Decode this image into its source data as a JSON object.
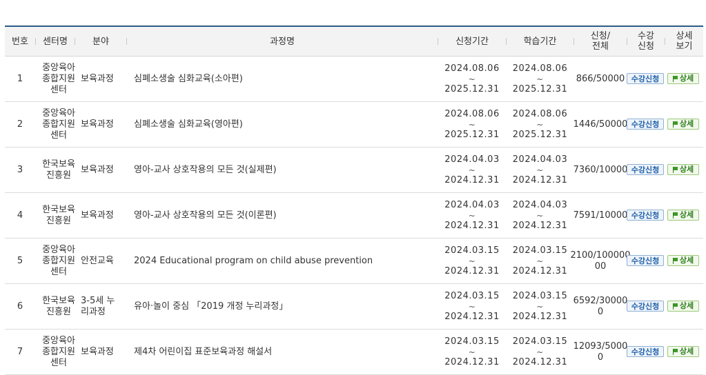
{
  "table": {
    "headers": {
      "no": "번호",
      "center": "센터명",
      "field": "분야",
      "course": "과정명",
      "apply_period": "신청기간",
      "study_period": "학습기간",
      "count": "신청/\n전체",
      "enroll": "수강\n신청",
      "detail": "상세\n보기"
    },
    "apply_label": "수강신청",
    "detail_label": "상세",
    "tilde": "~",
    "rows": [
      {
        "no": "1",
        "center": "중앙육아\n종합지원\n센터",
        "field": "보육과정",
        "course": "심폐소생술 심화교육(소아편)",
        "apply_start": "2024.08.06",
        "apply_end": "2025.12.31",
        "study_start": "2024.08.06",
        "study_end": "2025.12.31",
        "count": "866/50000"
      },
      {
        "no": "2",
        "center": "중앙육아\n종합지원\n센터",
        "field": "보육과정",
        "course": "심폐소생술 심화교육(영아편)",
        "apply_start": "2024.08.06",
        "apply_end": "2025.12.31",
        "study_start": "2024.08.06",
        "study_end": "2025.12.31",
        "count": "1446/50000"
      },
      {
        "no": "3",
        "center": "한국보육\n진흥원",
        "field": "보육과정",
        "course": "영아-교사 상호작용의 모든 것(실제편)",
        "apply_start": "2024.04.03",
        "apply_end": "2024.12.31",
        "study_start": "2024.04.03",
        "study_end": "2024.12.31",
        "count": "7360/10000"
      },
      {
        "no": "4",
        "center": "한국보육\n진흥원",
        "field": "보육과정",
        "course": "영아-교사 상호작용의 모든 것(이론편)",
        "apply_start": "2024.04.03",
        "apply_end": "2024.12.31",
        "study_start": "2024.04.03",
        "study_end": "2024.12.31",
        "count": "7591/10000"
      },
      {
        "no": "5",
        "center": "중앙육아\n종합지원\n센터",
        "field": "안전교육",
        "course": "2024 Educational program on child abuse prevention",
        "apply_start": "2024.03.15",
        "apply_end": "2024.12.31",
        "study_start": "2024.03.15",
        "study_end": "2024.12.31",
        "count": "2100/100000\n00"
      },
      {
        "no": "6",
        "center": "한국보육\n진흥원",
        "field": "3-5세 누\n리과정",
        "course": "유아·놀이 중심 「2019 개정 누리과정」",
        "apply_start": "2024.03.15",
        "apply_end": "2024.12.31",
        "study_start": "2024.03.15",
        "study_end": "2024.12.31",
        "count": "6592/30000\n0"
      },
      {
        "no": "7",
        "center": "중앙육아\n종합지원\n센터",
        "field": "보육과정",
        "course": "제4차 어린이집 표준보육과정 해설서",
        "apply_start": "2024.03.15",
        "apply_end": "2024.12.31",
        "study_start": "2024.03.15",
        "study_end": "2024.12.31",
        "count": "12093/5000\n0"
      }
    ]
  }
}
